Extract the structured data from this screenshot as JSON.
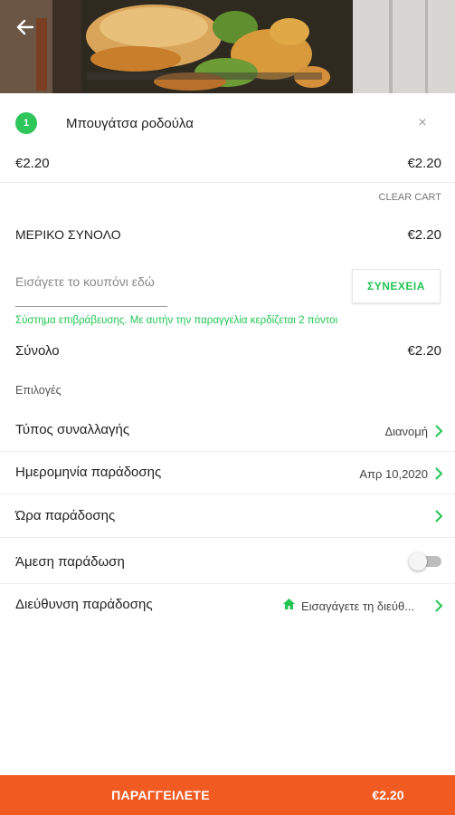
{
  "header": {
    "image_alt": "food-photo",
    "back_icon": "arrow-left-icon"
  },
  "cart": {
    "item": {
      "quantity": "1",
      "name": "Μπουγάτσα ροδούλα",
      "unit_price": "€2.20",
      "line_total": "€2.20",
      "remove_icon": "close-icon"
    },
    "clear_label": "CLEAR CART",
    "subtotal_label": "ΜΕΡΙΚΟ ΣΥΝΟΛΟ",
    "subtotal_value": "€2.20"
  },
  "coupon": {
    "placeholder": "Εισάγετε το κουπόνι εδώ",
    "continue_label": "ΣΥΝΕΧΕΙΑ",
    "rewards_text": "Σύστημα επιβράβευσης. Με αυτήν την παραγγελία κερδίζεται 2 πόντοι"
  },
  "total": {
    "label": "Σύνολο",
    "value": "€2.20"
  },
  "options": {
    "section_label": "Επιλογές",
    "transaction_type_label": "Τύπος συναλλαγής",
    "transaction_type_value": "Διανομή",
    "delivery_date_label": "Ημερομηνία παράδοσης",
    "delivery_date_value": "Απρ 10,2020",
    "delivery_time_label": "Ώρα παράδοσης",
    "delivery_time_value": "",
    "immediate_delivery_label": "Άμεση παράδωση",
    "immediate_delivery_on": false,
    "address_label": "Διεύθυνση παράδοσης",
    "address_value": "Εισαγάγετε τη διεύθ...",
    "address_icon": "home-icon"
  },
  "order_bar": {
    "label": "ΠΑΡΑΓΓΕΙΛΕΤΕ",
    "price": "€2.20"
  },
  "colors": {
    "accent_green": "#22c553",
    "order_orange": "#f15b22"
  }
}
